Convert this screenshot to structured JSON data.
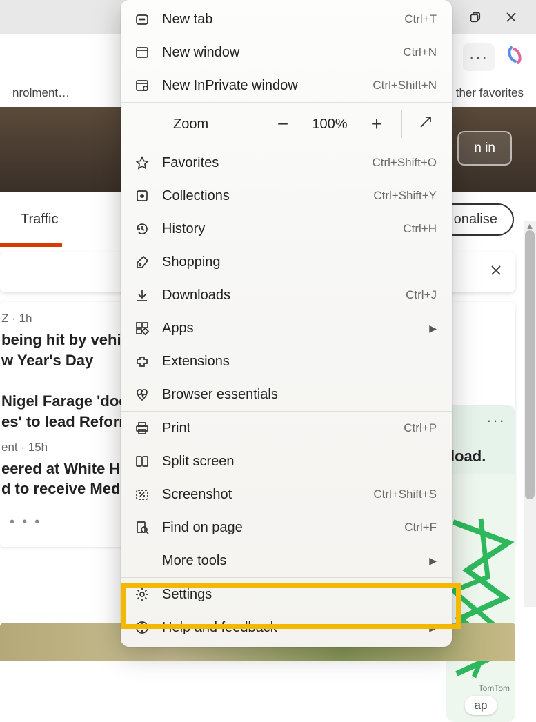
{
  "titlebar": {
    "restore_tooltip": "Restore",
    "close_tooltip": "Close"
  },
  "toolbar": {
    "more_label": "···"
  },
  "favorites_bar": {
    "left_truncated": "nrolment…",
    "right_label": "ther favorites"
  },
  "hero": {
    "signin_partial": "n in"
  },
  "tabs": {
    "traffic": "Traffic",
    "personalise_partial": "onalise"
  },
  "feed": {
    "item1_meta": "Z · 1h",
    "item1_headline_a": "being hit by vehicle",
    "item1_headline_b": "w Year's Day",
    "item2_headline_a": "Nigel Farage 'does",
    "item2_headline_b": "es' to lead Reform",
    "item3_meta": "ent · 15h",
    "item3_headline_a": "eered at White Ho",
    "item3_headline_b": "d to receive Medal"
  },
  "side": {
    "txt": "load.",
    "attrib": "TomTom",
    "pill": "ap",
    "more": "···"
  },
  "menu": {
    "new_tab": {
      "label": "New tab",
      "shortcut": "Ctrl+T"
    },
    "new_window": {
      "label": "New window",
      "shortcut": "Ctrl+N"
    },
    "inprivate": {
      "label": "New InPrivate window",
      "shortcut": "Ctrl+Shift+N"
    },
    "zoom": {
      "label": "Zoom",
      "value": "100%"
    },
    "favorites": {
      "label": "Favorites",
      "shortcut": "Ctrl+Shift+O"
    },
    "collections": {
      "label": "Collections",
      "shortcut": "Ctrl+Shift+Y"
    },
    "history": {
      "label": "History",
      "shortcut": "Ctrl+H"
    },
    "shopping": {
      "label": "Shopping"
    },
    "downloads": {
      "label": "Downloads",
      "shortcut": "Ctrl+J"
    },
    "apps": {
      "label": "Apps"
    },
    "extensions": {
      "label": "Extensions"
    },
    "essentials": {
      "label": "Browser essentials"
    },
    "print": {
      "label": "Print",
      "shortcut": "Ctrl+P"
    },
    "split": {
      "label": "Split screen"
    },
    "screenshot": {
      "label": "Screenshot",
      "shortcut": "Ctrl+Shift+S"
    },
    "find": {
      "label": "Find on page",
      "shortcut": "Ctrl+F"
    },
    "more_tools": {
      "label": "More tools"
    },
    "settings": {
      "label": "Settings"
    },
    "help": {
      "label": "Help and feedback"
    }
  }
}
